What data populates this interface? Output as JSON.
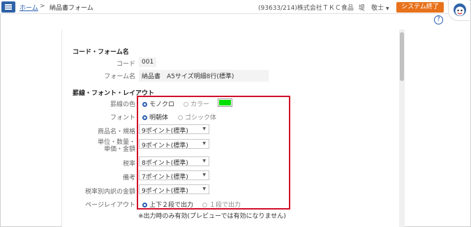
{
  "header": {
    "breadcrumb_home": "ホーム",
    "breadcrumb_sep": ">",
    "breadcrumb_page": "納品書フォーム",
    "company": "(93633/214)株式会社ＴＫＣ食品",
    "user": "堤　敬士",
    "exit_button": "システム終了",
    "help": "?"
  },
  "section_code": {
    "title": "コード・フォーム名",
    "code_label": "コード",
    "code_value": "001",
    "name_label": "フォーム名",
    "name_value": "納品書　A5サイズ明細8行(標準)"
  },
  "section_layout": {
    "title": "罫線・フォント・レイアウト",
    "line_color_label": "罫線の色",
    "line_color_options": [
      "モノクロ",
      "カラー"
    ],
    "line_color_selected": "モノクロ",
    "swatch_color": "#00e000",
    "font_label": "フォント",
    "font_options": [
      "明朝体",
      "ゴシック体"
    ],
    "font_selected": "明朝体",
    "product_label": "商品名・規格",
    "product_value": "9ポイント(標準)",
    "unit_label_line1": "単位・数量・",
    "unit_label_line2": "単価・金額",
    "unit_value": "9ポイント(標準)",
    "tax_label": "税率",
    "tax_value": "8ポイント(標準)",
    "remarks_label": "備考",
    "remarks_value": "7ポイント(標準)",
    "taxamount_label": "税率別内訳の金額",
    "taxamount_value": "9ポイント(標準)",
    "page_layout_label": "ページレイアウト",
    "page_layout_options": [
      "上下２段で出力",
      "１段で出力"
    ],
    "page_layout_selected": "上下２段で出力",
    "note": "※出力時のみ有効(プレビューでは有効になりません)"
  },
  "colors": {
    "accent_blue": "#2f63a8",
    "exit_orange": "#e8721c",
    "highlight_red": "#d0102a"
  }
}
